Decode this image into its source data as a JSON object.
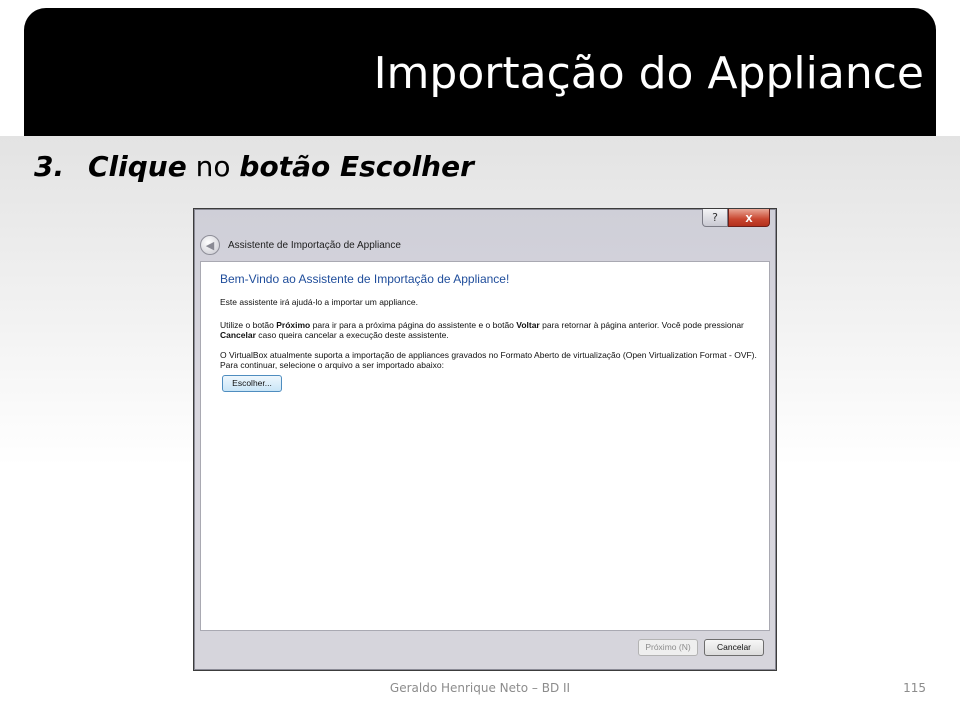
{
  "slide": {
    "title": "Importação do Appliance",
    "step_number": "3.",
    "step_word1": "Clique",
    "step_word2": " no ",
    "step_word3": "botão Escolher",
    "footer": "Geraldo Henrique Neto – BD II",
    "page_number": "115"
  },
  "dialog": {
    "help_label": "?",
    "close_label": "x",
    "title": "Assistente de Importação de Appliance",
    "welcome": "Bem-Vindo ao Assistente de Importação de Appliance!",
    "para1": "Este assistente irá ajudá-lo a importar um appliance.",
    "para2_a": "Utilize o botão ",
    "para2_b": "Próximo",
    "para2_c": " para ir para a próxima página do assistente e o botão ",
    "para2_d": "Voltar",
    "para2_e": " para retornar à página anterior. Você pode pressionar ",
    "para2_f": "Cancelar",
    "para2_g": " caso queira cancelar a execução deste assistente.",
    "para3": "O VirtualBox atualmente suporta a importação de appliances gravados no Formato Aberto de virtualização (Open Virtualization Format - OVF). Para continuar, selecione o arquivo a ser importado abaixo:",
    "choose_label": "Escolher...",
    "next_label": "Próximo (N)",
    "cancel_label": "Cancelar"
  },
  "colors": {
    "title_bar": "#000000",
    "welcome_text": "#1f4d9b",
    "close_button": "#c8452f"
  }
}
